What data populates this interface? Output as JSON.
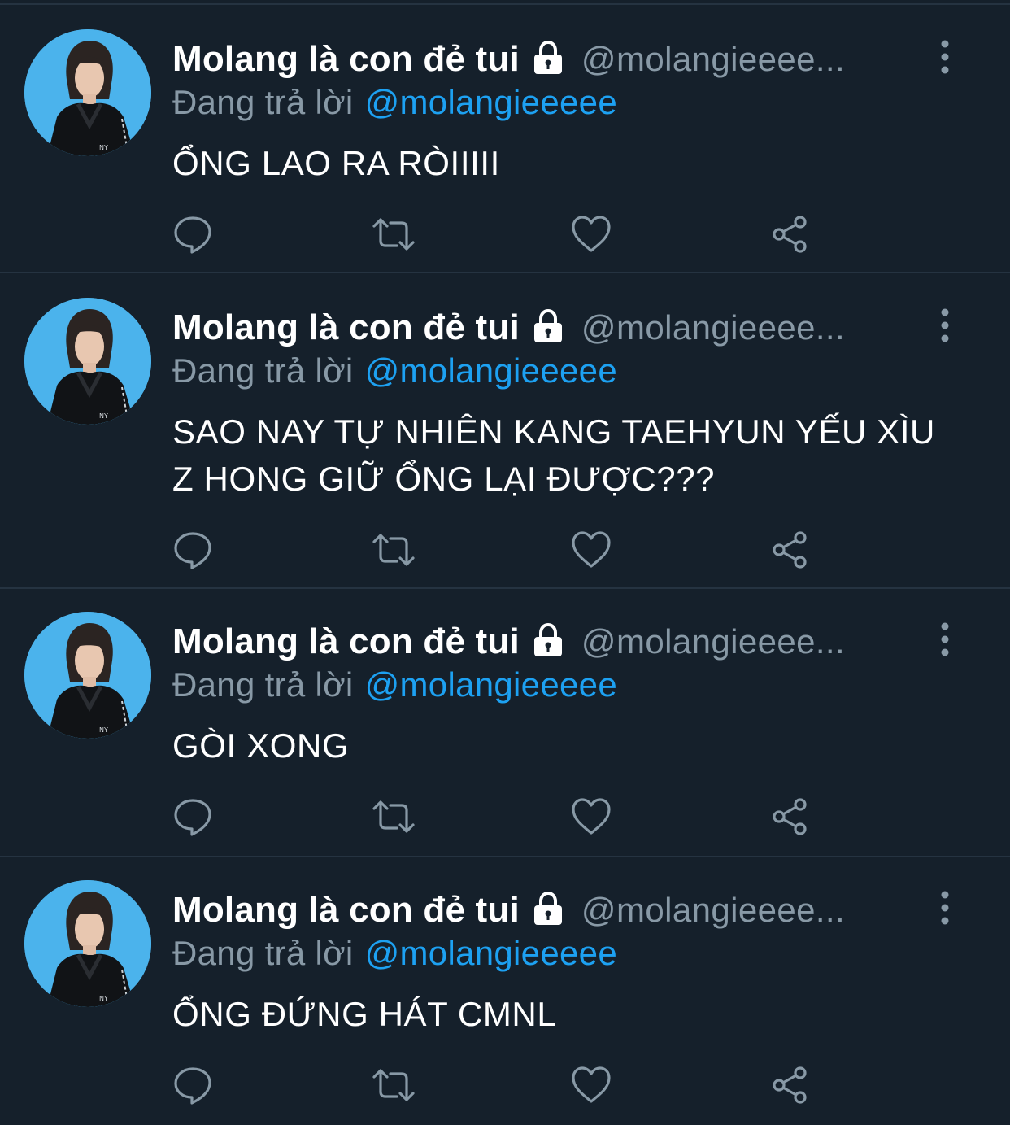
{
  "colors": {
    "background": "#15202b",
    "divider": "#253341",
    "secondary_text": "#8899a6",
    "mention": "#1da1f2",
    "avatar_bg": "#4bb3ec"
  },
  "tweets": [
    {
      "display_name": "Molang là con đẻ tui",
      "handle": "@molangieeee...",
      "reply_prefix": "Đang trả lời",
      "reply_mention": "@molangieeeee",
      "text": "ỔNG LAO RA RÒIIIII",
      "lock_icon": "lock-icon",
      "actions": [
        "reply-icon",
        "retweet-icon",
        "like-icon",
        "share-icon"
      ]
    },
    {
      "display_name": "Molang là con đẻ tui",
      "handle": "@molangieeee...",
      "reply_prefix": "Đang trả lời",
      "reply_mention": "@molangieeeee",
      "text": "SAO NAY TỰ NHIÊN KANG TAEHYUN YẾU XÌU Z HONG GIỮ ỔNG LẠI ĐƯỢC???",
      "lock_icon": "lock-icon",
      "actions": [
        "reply-icon",
        "retweet-icon",
        "like-icon",
        "share-icon"
      ]
    },
    {
      "display_name": "Molang là con đẻ tui",
      "handle": "@molangieeee...",
      "reply_prefix": "Đang trả lời",
      "reply_mention": "@molangieeeee",
      "text": "GÒI XONG",
      "lock_icon": "lock-icon",
      "actions": [
        "reply-icon",
        "retweet-icon",
        "like-icon",
        "share-icon"
      ]
    },
    {
      "display_name": "Molang là con đẻ tui",
      "handle": "@molangieeee...",
      "reply_prefix": "Đang trả lời",
      "reply_mention": "@molangieeeee",
      "text": "ỔNG ĐỨNG HÁT CMNL",
      "lock_icon": "lock-icon",
      "actions": [
        "reply-icon",
        "retweet-icon",
        "like-icon",
        "share-icon"
      ]
    }
  ]
}
